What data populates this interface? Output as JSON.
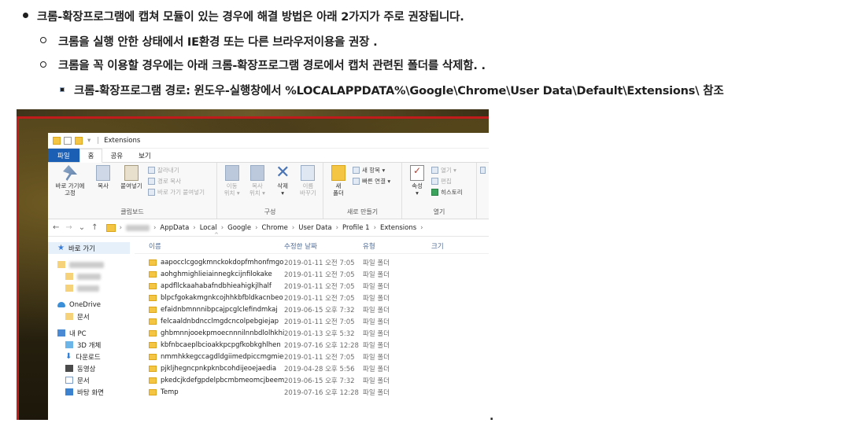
{
  "bullets": {
    "main": "크롬-확장프로그램에 캡쳐 모듈이 있는 경우에 해결 방법은 아래 2가지가 주로 권장됩니다.",
    "option1": "크롬을 실행 안한 상태에서 IE환경 또는 다른 브라우저이용을 권장 .",
    "option2": "크롬을 꼭 이용할 경우에는 아래 크롬-확장프로그램 경로에서  캡처 관련된 폴더를 삭제함. .",
    "path_note": "크롬-확장프로그램 경로: 윈도우-실행창에서  %LOCALAPPDATA%\\Google\\Chrome\\User Data\\Default\\Extensions\\ 참조",
    "trailing": "."
  },
  "explorer": {
    "title": "Extensions",
    "tabs": [
      "파일",
      "홈",
      "공유",
      "보기"
    ],
    "ribbon": {
      "clipboard": {
        "label": "클립보드",
        "pin": "바로 가기에\n고정",
        "copy": "복사",
        "paste": "붙여넣기",
        "cut": "잘라내기",
        "copy_path": "경로 복사",
        "paste_shortcut": "바로 가기 붙여넣기"
      },
      "organize": {
        "label": "구성",
        "move": "이동\n위치 ▾",
        "copy_to": "복사\n위치 ▾",
        "delete": "삭제\n▾",
        "rename": "이름\n바꾸기"
      },
      "new": {
        "label": "새로 만들기",
        "new_folder": "새\n폴더",
        "new_item": "새 항목 ▾",
        "easy_access": "빠른 연결 ▾"
      },
      "open": {
        "label": "열기",
        "properties": "속성\n▾",
        "open": "열기 ▾",
        "edit": "편집",
        "history": "히스토리"
      }
    },
    "address": {
      "crumbs": [
        "AppData",
        "Local",
        "Google",
        "Chrome",
        "User Data",
        "Profile 1",
        "Extensions"
      ]
    },
    "nav_pane": {
      "quick_access": "바로 가기",
      "onedrive": "OneDrive",
      "onedrive_docs": "문서",
      "this_pc": "내 PC",
      "objects3d": "3D 개체",
      "downloads": "다운로드",
      "videos": "동영상",
      "documents": "문서",
      "desktop": "바탕 화면"
    },
    "columns": {
      "name": "이름",
      "date": "수정한 날짜",
      "type": "유형",
      "size": "크기"
    },
    "files": [
      {
        "name": "aapocclcgogkmnckokdopfmhonfmgoek",
        "date": "2019-01-11 오전 7:05",
        "type": "파일 폴더"
      },
      {
        "name": "aohghmighlieiainnegkcijnfilokake",
        "date": "2019-01-11 오전 7:05",
        "type": "파일 폴더"
      },
      {
        "name": "apdfllckaahabafndbhieahigkjlhalf",
        "date": "2019-01-11 오전 7:05",
        "type": "파일 폴더"
      },
      {
        "name": "blpcfgokakmgnkcojhhkbfbldkacnbeo",
        "date": "2019-01-11 오전 7:05",
        "type": "파일 폴더"
      },
      {
        "name": "efaidnbmnnnibpcajpcglclefindmkaj",
        "date": "2019-06-15 오후 7:32",
        "type": "파일 폴더"
      },
      {
        "name": "felcaaldnbdncclmgdcncolpebgiejap",
        "date": "2019-01-11 오전 7:05",
        "type": "파일 폴더"
      },
      {
        "name": "ghbmnnjooekpmoecnnnilnnbdlolhkhi",
        "date": "2019-01-13 오후 5:32",
        "type": "파일 폴더"
      },
      {
        "name": "kbfnbcaeplbcioakkpcpgfkobkghlhen",
        "date": "2019-07-16 오후 12:28",
        "type": "파일 폴더"
      },
      {
        "name": "nmmhkkegccagdldgiimedpiccmgmieda",
        "date": "2019-01-11 오전 7:05",
        "type": "파일 폴더"
      },
      {
        "name": "pjkljhegncpnkpknbcohdijeoejaedia",
        "date": "2019-04-28 오후 5:56",
        "type": "파일 폴더"
      },
      {
        "name": "pkedcjkdefgpdelpbcmbmeomcjbeemfm",
        "date": "2019-06-15 오후 7:32",
        "type": "파일 폴더"
      },
      {
        "name": "Temp",
        "date": "2019-07-16 오후 12:28",
        "type": "파일 폴더"
      }
    ]
  },
  "colors": {
    "highlight_border": "#c21b1b",
    "file_tab": "#1a5fb4",
    "folder": "#f4c542"
  }
}
